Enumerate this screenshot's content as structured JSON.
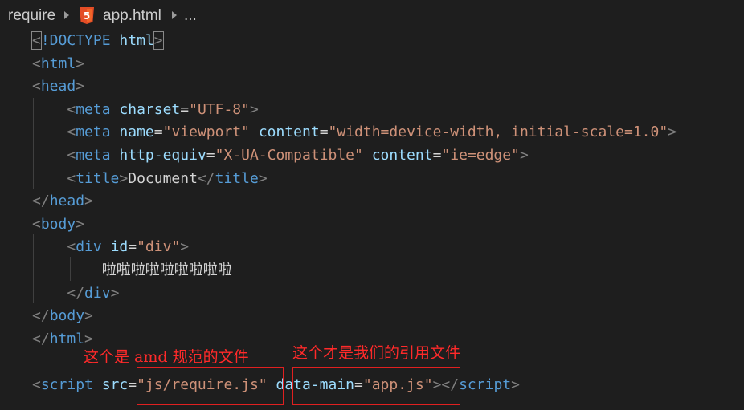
{
  "breadcrumb": {
    "folder": "require",
    "file": "app.html",
    "more": "..."
  },
  "code_lines": [
    {
      "parts": [
        [
          "p",
          "<"
        ],
        [
          "t",
          "!DOCTYPE"
        ],
        [
          "x",
          " "
        ],
        [
          "a",
          "html"
        ],
        [
          "p",
          ">"
        ]
      ]
    },
    {
      "parts": [
        [
          "p",
          "<"
        ],
        [
          "t",
          "html"
        ],
        [
          "p",
          ">"
        ]
      ]
    },
    {
      "parts": [
        [
          "p",
          "<"
        ],
        [
          "t",
          "head"
        ],
        [
          "p",
          ">"
        ]
      ]
    },
    {
      "parts": [
        [
          "x",
          "    "
        ],
        [
          "p",
          "<"
        ],
        [
          "t",
          "meta"
        ],
        [
          "x",
          " "
        ],
        [
          "a",
          "charset"
        ],
        [
          "x",
          "="
        ],
        [
          "s",
          "\"UTF-8\""
        ],
        [
          "p",
          ">"
        ]
      ]
    },
    {
      "parts": [
        [
          "x",
          "    "
        ],
        [
          "p",
          "<"
        ],
        [
          "t",
          "meta"
        ],
        [
          "x",
          " "
        ],
        [
          "a",
          "name"
        ],
        [
          "x",
          "="
        ],
        [
          "s",
          "\"viewport\""
        ],
        [
          "x",
          " "
        ],
        [
          "a",
          "content"
        ],
        [
          "x",
          "="
        ],
        [
          "s",
          "\"width=device-width, initial-scale=1.0\""
        ],
        [
          "p",
          ">"
        ]
      ]
    },
    {
      "parts": [
        [
          "x",
          "    "
        ],
        [
          "p",
          "<"
        ],
        [
          "t",
          "meta"
        ],
        [
          "x",
          " "
        ],
        [
          "a",
          "http-equiv"
        ],
        [
          "x",
          "="
        ],
        [
          "s",
          "\"X-UA-Compatible\""
        ],
        [
          "x",
          " "
        ],
        [
          "a",
          "content"
        ],
        [
          "x",
          "="
        ],
        [
          "s",
          "\"ie=edge\""
        ],
        [
          "p",
          ">"
        ]
      ]
    },
    {
      "parts": [
        [
          "x",
          "    "
        ],
        [
          "p",
          "<"
        ],
        [
          "t",
          "title"
        ],
        [
          "p",
          ">"
        ],
        [
          "x",
          "Document"
        ],
        [
          "p",
          "</"
        ],
        [
          "t",
          "title"
        ],
        [
          "p",
          ">"
        ]
      ]
    },
    {
      "parts": [
        [
          "p",
          "</"
        ],
        [
          "t",
          "head"
        ],
        [
          "p",
          ">"
        ]
      ]
    },
    {
      "parts": [
        [
          "p",
          "<"
        ],
        [
          "t",
          "body"
        ],
        [
          "p",
          ">"
        ]
      ]
    },
    {
      "parts": [
        [
          "x",
          "    "
        ],
        [
          "p",
          "<"
        ],
        [
          "t",
          "div"
        ],
        [
          "x",
          " "
        ],
        [
          "a",
          "id"
        ],
        [
          "x",
          "="
        ],
        [
          "s",
          "\"div\""
        ],
        [
          "p",
          ">"
        ]
      ]
    },
    {
      "parts": [
        [
          "x",
          "        "
        ],
        [
          "cjk",
          "啦啦啦啦啦啦啦啦啦"
        ]
      ]
    },
    {
      "parts": [
        [
          "x",
          "    "
        ],
        [
          "p",
          "</"
        ],
        [
          "t",
          "div"
        ],
        [
          "p",
          ">"
        ]
      ]
    },
    {
      "parts": [
        [
          "p",
          "</"
        ],
        [
          "t",
          "body"
        ],
        [
          "p",
          ">"
        ]
      ]
    },
    {
      "parts": [
        [
          "p",
          "</"
        ],
        [
          "t",
          "html"
        ],
        [
          "p",
          ">"
        ]
      ]
    },
    {
      "parts": []
    },
    {
      "parts": [
        [
          "p",
          "<"
        ],
        [
          "t",
          "script"
        ],
        [
          "x",
          " "
        ],
        [
          "a",
          "src"
        ],
        [
          "x",
          "="
        ],
        [
          "s",
          "\"js/require.js\""
        ],
        [
          "x",
          " "
        ],
        [
          "a",
          "data-main"
        ],
        [
          "x",
          "="
        ],
        [
          "s",
          "\"app.js\""
        ],
        [
          "p",
          "></"
        ],
        [
          "t",
          "script"
        ],
        [
          "p",
          ">"
        ]
      ]
    }
  ],
  "annotations": {
    "left": "这个是 amd 规范的文件",
    "right": "这个才是我们的引用文件"
  },
  "colors": {
    "background": "#1e1e1e",
    "tag": "#569cd6",
    "punct": "#808080",
    "attr": "#9cdcfe",
    "string": "#ce9178",
    "annotation": "#ff2a2a",
    "html5_icon": "#e44d26"
  }
}
